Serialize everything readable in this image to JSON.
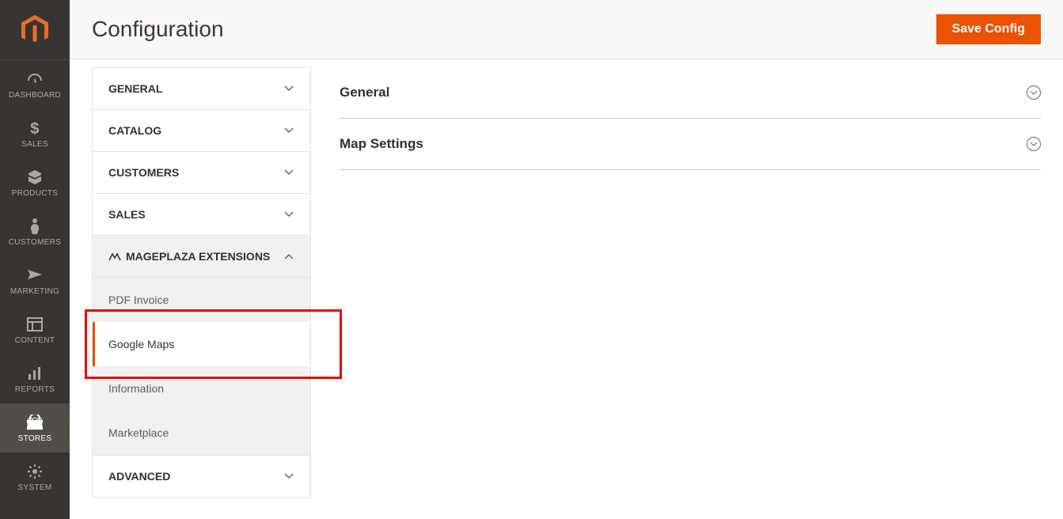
{
  "page": {
    "title": "Configuration",
    "save_button": "Save Config"
  },
  "nav": {
    "items": [
      {
        "label": "DASHBOARD"
      },
      {
        "label": "SALES"
      },
      {
        "label": "PRODUCTS"
      },
      {
        "label": "CUSTOMERS"
      },
      {
        "label": "MARKETING"
      },
      {
        "label": "CONTENT"
      },
      {
        "label": "REPORTS"
      },
      {
        "label": "STORES"
      },
      {
        "label": "SYSTEM"
      }
    ],
    "active_index": 7
  },
  "config_tabs": {
    "groups": [
      {
        "label": "GENERAL",
        "expanded": false
      },
      {
        "label": "CATALOG",
        "expanded": false
      },
      {
        "label": "CUSTOMERS",
        "expanded": false
      },
      {
        "label": "SALES",
        "expanded": false
      },
      {
        "label": "MAGEPLAZA EXTENSIONS",
        "expanded": true,
        "has_icon": true,
        "items": [
          {
            "label": "PDF Invoice"
          },
          {
            "label": "Google Maps",
            "active": true
          },
          {
            "label": "Information"
          },
          {
            "label": "Marketplace"
          }
        ]
      },
      {
        "label": "ADVANCED",
        "expanded": false
      }
    ]
  },
  "panels": [
    {
      "title": "General"
    },
    {
      "title": "Map Settings"
    }
  ]
}
